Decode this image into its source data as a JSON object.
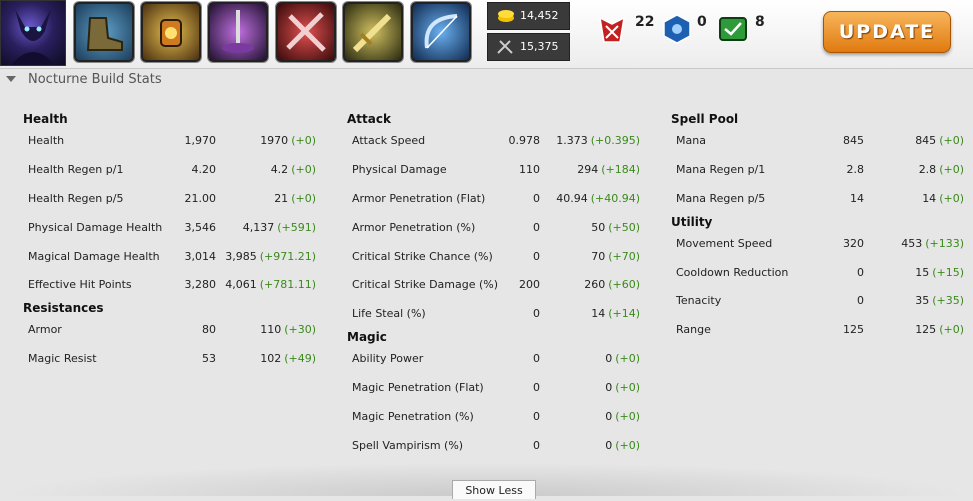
{
  "header": {
    "champion_icon": "nocturne-portrait",
    "items": [
      {
        "icon": "boots-icon"
      },
      {
        "icon": "lantern-icon"
      },
      {
        "icon": "sword-pedestal-icon"
      },
      {
        "icon": "crossed-blades-icon"
      },
      {
        "icon": "golden-sword-icon"
      },
      {
        "icon": "bow-icon"
      }
    ],
    "gold": "14,452",
    "cost": "15,375",
    "kills": "22",
    "deaths": "0",
    "assists": "8",
    "update_label": "UPDATE"
  },
  "section_title": "Nocturne Build Stats",
  "groups": {
    "health": {
      "title": "Health",
      "rows": [
        {
          "label": "Health",
          "base": "1,970",
          "total": "1970",
          "bonus": "(+0)"
        },
        {
          "label": "Health Regen p/1",
          "base": "4.20",
          "total": "4.2",
          "bonus": "(+0)"
        },
        {
          "label": "Health Regen p/5",
          "base": "21.00",
          "total": "21",
          "bonus": "(+0)"
        },
        {
          "label": "Physical Damage Health",
          "base": "3,546",
          "total": "4,137",
          "bonus": "(+591)"
        },
        {
          "label": "Magical Damage Health",
          "base": "3,014",
          "total": "3,985",
          "bonus": "(+971.21)"
        },
        {
          "label": "Effective Hit Points",
          "base": "3,280",
          "total": "4,061",
          "bonus": "(+781.11)"
        }
      ]
    },
    "resistances": {
      "title": "Resistances",
      "rows": [
        {
          "label": "Armor",
          "base": "80",
          "total": "110",
          "bonus": "(+30)"
        },
        {
          "label": "Magic Resist",
          "base": "53",
          "total": "102",
          "bonus": "(+49)"
        }
      ]
    },
    "attack": {
      "title": "Attack",
      "rows": [
        {
          "label": "Attack Speed",
          "base": "0.978",
          "total": "1.373",
          "bonus": "(+0.395)"
        },
        {
          "label": "Physical Damage",
          "base": "110",
          "total": "294",
          "bonus": "(+184)"
        },
        {
          "label": "Armor Penetration (Flat)",
          "base": "0",
          "total": "40.94",
          "bonus": "(+40.94)"
        },
        {
          "label": "Armor Penetration (%)",
          "base": "0",
          "total": "50",
          "bonus": "(+50)"
        },
        {
          "label": "Critical Strike Chance (%)",
          "base": "0",
          "total": "70",
          "bonus": "(+70)"
        },
        {
          "label": "Critical Strike Damage (%)",
          "base": "200",
          "total": "260",
          "bonus": "(+60)"
        },
        {
          "label": "Life Steal (%)",
          "base": "0",
          "total": "14",
          "bonus": "(+14)"
        }
      ]
    },
    "magic": {
      "title": "Magic",
      "rows": [
        {
          "label": "Ability Power",
          "base": "0",
          "total": "0",
          "bonus": "(+0)"
        },
        {
          "label": "Magic Penetration (Flat)",
          "base": "0",
          "total": "0",
          "bonus": "(+0)"
        },
        {
          "label": "Magic Penetration (%)",
          "base": "0",
          "total": "0",
          "bonus": "(+0)"
        },
        {
          "label": "Spell Vampirism (%)",
          "base": "0",
          "total": "0",
          "bonus": "(+0)"
        }
      ]
    },
    "spellpool": {
      "title": "Spell Pool",
      "rows": [
        {
          "label": "Mana",
          "base": "845",
          "total": "845",
          "bonus": "(+0)"
        },
        {
          "label": "Mana Regen p/1",
          "base": "2.8",
          "total": "2.8",
          "bonus": "(+0)"
        },
        {
          "label": "Mana Regen p/5",
          "base": "14",
          "total": "14",
          "bonus": "(+0)"
        }
      ]
    },
    "utility": {
      "title": "Utility",
      "rows": [
        {
          "label": "Movement Speed",
          "base": "320",
          "total": "453",
          "bonus": "(+133)"
        },
        {
          "label": "Cooldown Reduction",
          "base": "0",
          "total": "15",
          "bonus": "(+15)"
        },
        {
          "label": "Tenacity",
          "base": "0",
          "total": "35",
          "bonus": "(+35)"
        },
        {
          "label": "Range",
          "base": "125",
          "total": "125",
          "bonus": "(+0)"
        }
      ]
    }
  },
  "show_less_label": "Show Less",
  "colors": {
    "bonus": "#3a8a1a",
    "update": "#e88a1a"
  }
}
